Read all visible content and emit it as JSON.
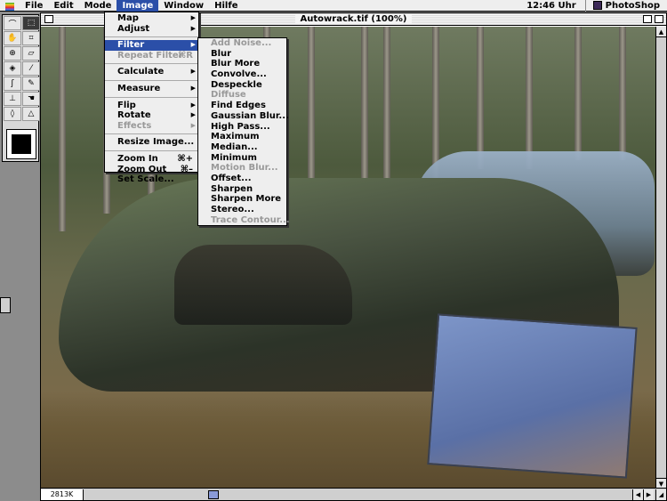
{
  "menubar": {
    "apple_icon": "apple-logo",
    "items": [
      "File",
      "Edit",
      "Mode",
      "Image",
      "Window",
      "Hilfe"
    ],
    "active_item": "Image",
    "clock": "12:46 Uhr",
    "app_name": "PhotoShop"
  },
  "document": {
    "title": "Autowrack.tif (100%)",
    "status_size": "2813K"
  },
  "toolbox": {
    "tools": [
      "lasso-icon",
      "marquee-icon",
      "hand-icon",
      "crop-icon",
      "crosshair-icon",
      "eraser-icon",
      "bucket-icon",
      "eyedropper-icon",
      "brush-icon",
      "pencil-icon",
      "stamp-icon",
      "smudge-icon",
      "drop-icon",
      "cone-icon"
    ],
    "selected": "marquee-icon",
    "foreground_color": "#000000",
    "background_color": "#ffffff"
  },
  "image_menu": {
    "items": [
      {
        "label": "Map",
        "submenu": true
      },
      {
        "label": "Adjust",
        "submenu": true
      },
      {
        "separator": true
      },
      {
        "label": "Filter",
        "submenu": true,
        "highlighted": true
      },
      {
        "label": "Repeat Filter",
        "shortcut": "⌘R",
        "disabled": true
      },
      {
        "separator": true
      },
      {
        "label": "Calculate",
        "submenu": true
      },
      {
        "separator": true
      },
      {
        "label": "Measure",
        "submenu": true
      },
      {
        "separator": true
      },
      {
        "label": "Flip",
        "submenu": true
      },
      {
        "label": "Rotate",
        "submenu": true
      },
      {
        "label": "Effects",
        "submenu": true,
        "disabled": true
      },
      {
        "separator": true
      },
      {
        "label": "Resize Image..."
      },
      {
        "separator": true
      },
      {
        "label": "Zoom In",
        "shortcut": "⌘+"
      },
      {
        "label": "Zoom Out",
        "shortcut": "⌘–"
      },
      {
        "label": "Set Scale..."
      }
    ]
  },
  "filter_menu": {
    "items": [
      {
        "label": "Add Noise...",
        "disabled": true
      },
      {
        "label": "Blur"
      },
      {
        "label": "Blur More"
      },
      {
        "label": "Convolve..."
      },
      {
        "label": "Despeckle"
      },
      {
        "label": "Diffuse",
        "disabled": true
      },
      {
        "label": "Find Edges"
      },
      {
        "label": "Gaussian Blur..."
      },
      {
        "label": "High Pass..."
      },
      {
        "label": "Maximum"
      },
      {
        "label": "Median..."
      },
      {
        "label": "Minimum"
      },
      {
        "label": "Motion Blur...",
        "disabled": true
      },
      {
        "label": "Offset..."
      },
      {
        "label": "Sharpen"
      },
      {
        "label": "Sharpen More"
      },
      {
        "label": "Stereo..."
      },
      {
        "label": "Trace Contour...",
        "disabled": true
      }
    ]
  },
  "colors": {
    "menu_highlight": "#2b4fa8",
    "menu_bg": "#eeeeee",
    "disabled_text": "#999999"
  }
}
